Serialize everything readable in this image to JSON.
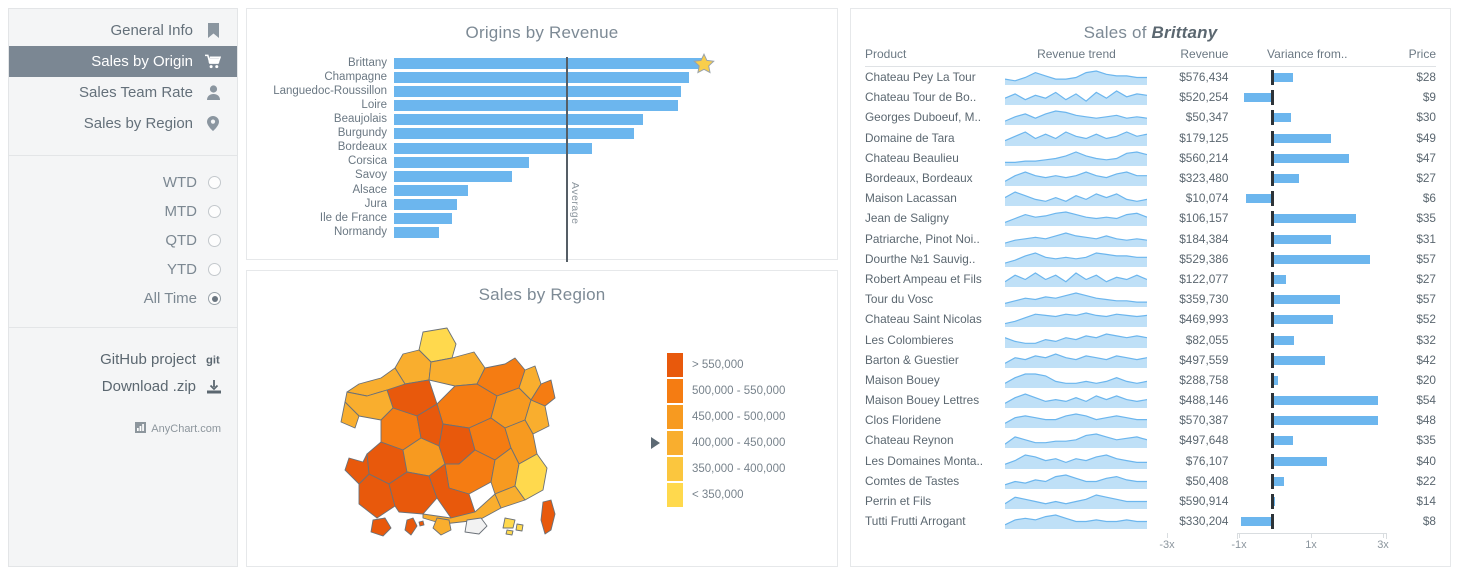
{
  "sidebar": {
    "nav": [
      {
        "label": "General Info",
        "icon": "bookmark-icon",
        "active": false
      },
      {
        "label": "Sales by Origin",
        "icon": "cart-icon",
        "active": true
      },
      {
        "label": "Sales Team Rate",
        "icon": "person-icon",
        "active": false
      },
      {
        "label": "Sales by Region",
        "icon": "map-pin-icon",
        "active": false
      }
    ],
    "periods": [
      {
        "label": "WTD",
        "selected": false
      },
      {
        "label": "MTD",
        "selected": false
      },
      {
        "label": "QTD",
        "selected": false
      },
      {
        "label": "YTD",
        "selected": false
      },
      {
        "label": "All Time",
        "selected": true
      }
    ],
    "links": [
      {
        "label": "GitHub project",
        "icon": "git-icon"
      },
      {
        "label": "Download .zip",
        "icon": "download-icon"
      }
    ],
    "brand": "AnyChart.com",
    "active_color": "#7b8793"
  },
  "chart_data": [
    {
      "type": "bar",
      "title": "Origins by Revenue",
      "orientation": "horizontal",
      "xlabel": "",
      "ylabel": "",
      "annotation": "Average",
      "average_value": 330000,
      "highlight": {
        "category": "Brittany",
        "marker": "star",
        "color": "#F9CE4C"
      },
      "bar_color": "#6cb6ee",
      "categories": [
        "Brittany",
        "Champagne",
        "Languedoc-Roussillon",
        "Loire",
        "Beaujolais",
        "Burgundy",
        "Bordeaux",
        "Corsica",
        "Savoy",
        "Alsace",
        "Jura",
        "Ile de France",
        "Normandy"
      ],
      "values": [
        596000,
        568000,
        552000,
        546000,
        478000,
        461000,
        381000,
        260000,
        226000,
        142000,
        121000,
        112000,
        86000
      ]
    },
    {
      "type": "choropleth",
      "title": "Sales by Region",
      "legend_position": "right",
      "legend": [
        {
          "label": "> 550,000",
          "color": "#E8590C"
        },
        {
          "label": "500,000 - 550,000",
          "color": "#F57C12"
        },
        {
          "label": "450,000 - 500,000",
          "color": "#F79A20"
        },
        {
          "label": "400,000 - 450,000",
          "color": "#F9AE2E",
          "pointer": true
        },
        {
          "label": "350,000 - 400,000",
          "color": "#FBC63E"
        },
        {
          "label": "< 350,000",
          "color": "#FFD94D"
        }
      ]
    },
    {
      "type": "table",
      "title_prefix": "Sales of ",
      "title_region": "Brittany",
      "columns": [
        "Product",
        "Revenue trend",
        "Revenue",
        "Variance from..",
        "Price"
      ],
      "variance_axis": {
        "ticks": [
          "-3x",
          "-1x",
          "1x",
          "3x"
        ],
        "values": [
          -3,
          -1,
          1,
          3
        ]
      },
      "bar_color": "#6cb6ee",
      "reference_color": "#2d3338",
      "rows": [
        {
          "product": "Chateau Pey La Tour",
          "revenue": "$576,434",
          "variance": 0.55,
          "price": "$28",
          "trend": [
            5,
            4,
            6,
            9,
            7,
            5,
            5,
            6,
            9,
            10,
            8,
            7,
            7,
            6,
            6
          ]
        },
        {
          "product": "Chateau Tour de Bo..",
          "revenue": "$520,254",
          "variance": -0.75,
          "price": "$9",
          "trend": [
            8,
            11,
            7,
            10,
            8,
            12,
            7,
            11,
            6,
            12,
            8,
            13,
            9,
            11,
            10
          ]
        },
        {
          "product": "Georges Duboeuf, M..",
          "revenue": "$50,347",
          "variance": 0.5,
          "price": "$30",
          "trend": [
            6,
            9,
            11,
            8,
            11,
            13,
            12,
            10,
            9,
            8,
            9,
            10,
            8,
            9,
            8
          ]
        },
        {
          "product": "Domaine de Tara",
          "revenue": "$179,125",
          "variance": 1.6,
          "price": "$49",
          "trend": [
            8,
            10,
            12,
            9,
            11,
            9,
            12,
            10,
            9,
            11,
            9,
            10,
            12,
            10,
            11
          ]
        },
        {
          "product": "Chateau Beaulieu",
          "revenue": "$560,214",
          "variance": 2.1,
          "price": "$47",
          "trend": [
            4,
            4,
            5,
            5,
            6,
            7,
            9,
            12,
            9,
            7,
            6,
            7,
            11,
            12,
            10
          ]
        },
        {
          "product": "Bordeaux, Bordeaux",
          "revenue": "$323,480",
          "variance": 0.72,
          "price": "$27",
          "trend": [
            7,
            10,
            12,
            10,
            9,
            10,
            9,
            10,
            12,
            10,
            9,
            11,
            12,
            10,
            10
          ]
        },
        {
          "product": "Maison Lacassan",
          "revenue": "$10,074",
          "variance": -0.7,
          "price": "$6",
          "trend": [
            10,
            13,
            11,
            9,
            8,
            10,
            8,
            11,
            9,
            12,
            10,
            12,
            9,
            8,
            9
          ]
        },
        {
          "product": "Jean de Saligny",
          "revenue": "$106,157",
          "variance": 2.3,
          "price": "$35",
          "trend": [
            5,
            8,
            11,
            9,
            10,
            12,
            13,
            11,
            9,
            8,
            9,
            8,
            11,
            12,
            9
          ]
        },
        {
          "product": "Patriarche, Pinot Noi..",
          "revenue": "$184,384",
          "variance": 1.6,
          "price": "$31",
          "trend": [
            6,
            8,
            9,
            10,
            9,
            11,
            13,
            11,
            10,
            9,
            11,
            9,
            8,
            9,
            8
          ]
        },
        {
          "product": "Dourthe №1 Sauvig..",
          "revenue": "$529,386",
          "variance": 2.7,
          "price": "$57",
          "trend": [
            5,
            7,
            10,
            12,
            9,
            8,
            9,
            8,
            9,
            12,
            11,
            10,
            10,
            9,
            9
          ]
        },
        {
          "product": "Robert Ampeau et Fils",
          "revenue": "$122,077",
          "variance": 0.35,
          "price": "$27",
          "trend": [
            8,
            11,
            9,
            12,
            9,
            11,
            8,
            12,
            9,
            11,
            8,
            10,
            9,
            11,
            9
          ]
        },
        {
          "product": "Tour du Vosc",
          "revenue": "$359,730",
          "variance": 1.85,
          "price": "$57",
          "trend": [
            6,
            8,
            10,
            9,
            11,
            10,
            12,
            14,
            12,
            10,
            9,
            8,
            8,
            7,
            7
          ]
        },
        {
          "product": "Chateau Saint Nicolas",
          "revenue": "$469,993",
          "variance": 1.65,
          "price": "$52",
          "trend": [
            4,
            6,
            9,
            12,
            11,
            10,
            12,
            11,
            13,
            11,
            10,
            12,
            11,
            10,
            11
          ]
        },
        {
          "product": "Les Colombieres",
          "revenue": "$82,055",
          "variance": 0.58,
          "price": "$32",
          "trend": [
            9,
            7,
            6,
            6,
            8,
            7,
            9,
            8,
            10,
            9,
            11,
            10,
            9,
            10,
            9
          ]
        },
        {
          "product": "Barton & Guestier",
          "revenue": "$497,559",
          "variance": 1.45,
          "price": "$42",
          "trend": [
            7,
            10,
            9,
            11,
            10,
            12,
            10,
            9,
            11,
            10,
            9,
            11,
            10,
            9,
            10
          ]
        },
        {
          "product": "Maison Bouey",
          "revenue": "$288,758",
          "variance": 0.12,
          "price": "$20",
          "trend": [
            8,
            11,
            13,
            13,
            12,
            9,
            8,
            8,
            9,
            8,
            9,
            11,
            9,
            8,
            9
          ]
        },
        {
          "product": "Maison Bouey Lettres",
          "revenue": "$488,146",
          "variance": 2.9,
          "price": "$54",
          "trend": [
            8,
            11,
            13,
            11,
            9,
            10,
            9,
            11,
            9,
            12,
            10,
            12,
            10,
            9,
            10
          ]
        },
        {
          "product": "Clos Floridene",
          "revenue": "$570,387",
          "variance": 2.9,
          "price": "$48",
          "trend": [
            7,
            10,
            11,
            10,
            9,
            9,
            11,
            12,
            11,
            9,
            10,
            11,
            10,
            9,
            9
          ]
        },
        {
          "product": "Chateau Reynon",
          "revenue": "$497,648",
          "variance": 0.55,
          "price": "$35",
          "trend": [
            6,
            11,
            9,
            7,
            7,
            8,
            8,
            9,
            12,
            13,
            11,
            9,
            10,
            11,
            9
          ]
        },
        {
          "product": "Les Domaines Monta..",
          "revenue": "$76,107",
          "variance": 1.5,
          "price": "$40",
          "trend": [
            7,
            9,
            12,
            11,
            9,
            10,
            8,
            10,
            9,
            11,
            12,
            10,
            9,
            8,
            8
          ]
        },
        {
          "product": "Comtes de Tastes",
          "revenue": "$50,408",
          "variance": 0.3,
          "price": "$22",
          "trend": [
            7,
            9,
            8,
            10,
            9,
            12,
            13,
            11,
            9,
            9,
            11,
            12,
            10,
            9,
            9
          ]
        },
        {
          "product": "Perrin et Fils",
          "revenue": "$590,914",
          "variance": 0.05,
          "price": "$14",
          "trend": [
            8,
            11,
            10,
            9,
            8,
            9,
            8,
            9,
            10,
            12,
            11,
            10,
            9,
            9,
            9
          ]
        },
        {
          "product": "Tutti Frutti Arrogant",
          "revenue": "$330,204",
          "variance": -0.85,
          "price": "$8",
          "trend": [
            7,
            10,
            11,
            10,
            12,
            13,
            11,
            9,
            9,
            10,
            9,
            9,
            10,
            9,
            9
          ]
        }
      ]
    }
  ]
}
